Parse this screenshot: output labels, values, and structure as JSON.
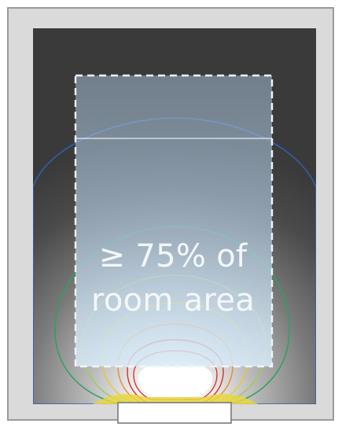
{
  "diagram": {
    "label_line_1": "≥ 75% of",
    "label_line_2": "room area"
  },
  "colors": {
    "wall": "#dadada",
    "wall_outline": "#9a9a9a",
    "floor_dark": "#3b3b3b",
    "highlight_area": "#b8d4ea",
    "contour_blue": "#2f5fa8",
    "contour_green": "#2fa060",
    "contour_light_green": "#9ccc55",
    "contour_yellow": "#e8c830",
    "contour_orange": "#e88a30",
    "contour_red": "#d83020",
    "window_glare": "#ffffff"
  }
}
